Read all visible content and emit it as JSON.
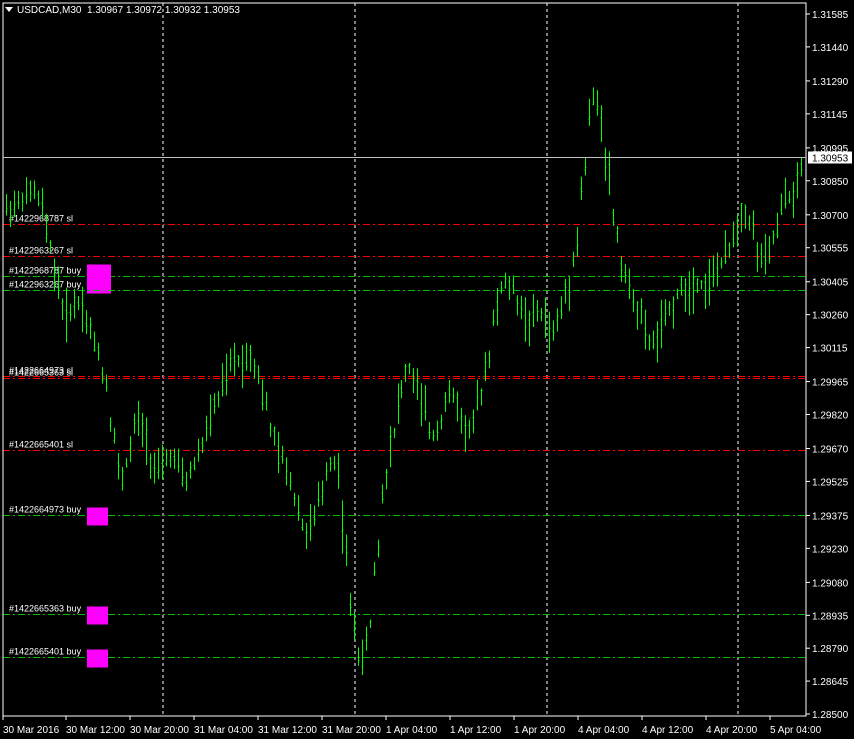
{
  "header": {
    "symbol": "USDCAD,M30",
    "ohlc": "1.30967 1.30972 1.30932 1.30953"
  },
  "colors": {
    "background": "#000000",
    "candle": "#00ff00",
    "grid": "#ffffff",
    "stop_loss": "#ff0000",
    "buy_level": "#00c000",
    "marker": "#ff00ff",
    "bid_line": "#c0c0c0"
  },
  "chart_data": {
    "type": "line",
    "title": "USDCAD,M30",
    "y_ticks": [
      "1.31585",
      "1.31440",
      "1.31290",
      "1.31145",
      "1.30995",
      "1.30850",
      "1.30700",
      "1.30555",
      "1.30405",
      "1.30260",
      "1.30115",
      "1.29965",
      "1.29820",
      "1.29670",
      "1.29525",
      "1.29375",
      "1.29230",
      "1.29080",
      "1.28935",
      "1.28790",
      "1.28645",
      "1.28500"
    ],
    "ylim": [
      1.285,
      1.31585
    ],
    "x_ticks": [
      "30 Mar 2016",
      "30 Mar 12:00",
      "30 Mar 20:00",
      "31 Mar 04:00",
      "31 Mar 12:00",
      "31 Mar 20:00",
      "1 Apr 04:00",
      "1 Apr 12:00",
      "1 Apr 20:00",
      "4 Apr 04:00",
      "4 Apr 12:00",
      "4 Apr 20:00",
      "5 Apr 04:00"
    ],
    "current_price": "1.30953",
    "series": [
      {
        "x_index": [
          0,
          2,
          4,
          6,
          8,
          10,
          12,
          14,
          16,
          18,
          20,
          22,
          24,
          26,
          28,
          30,
          32,
          34,
          36,
          38,
          40,
          42,
          44,
          46,
          48,
          50,
          52,
          54,
          56,
          58,
          60,
          62,
          64,
          66,
          68,
          70,
          72,
          74,
          76,
          78,
          80,
          82,
          84,
          86,
          88,
          90,
          92,
          94,
          96,
          98,
          100,
          102,
          104,
          106,
          108,
          110,
          112,
          114,
          116,
          118,
          120,
          122,
          124,
          126,
          128,
          130,
          132,
          134,
          136,
          138,
          140,
          142,
          144,
          146,
          148,
          150,
          152,
          154,
          156,
          158,
          160,
          162,
          164,
          166,
          168,
          170,
          172,
          174,
          176,
          178,
          180,
          182,
          184,
          186,
          188,
          190,
          192,
          194,
          196,
          198
        ],
        "values": [
          1.3073,
          1.3076,
          1.3079,
          1.3081,
          1.3072,
          1.3052,
          1.3036,
          1.3022,
          1.3034,
          1.3029,
          1.3017,
          1.3008,
          1.2992,
          1.2966,
          1.295,
          1.2972,
          1.2982,
          1.2969,
          1.2955,
          1.296,
          1.2965,
          1.2958,
          1.2951,
          1.2963,
          1.297,
          1.2983,
          1.299,
          1.3001,
          1.3008,
          1.3004,
          1.301,
          1.2997,
          1.2983,
          1.2968,
          1.2961,
          1.2951,
          1.2939,
          1.2927,
          1.2939,
          1.295,
          1.2965,
          1.2956,
          1.291,
          1.2883,
          1.287,
          1.2896,
          1.2932,
          1.2963,
          1.2978,
          1.2997,
          1.3004,
          1.2991,
          1.2981,
          1.297,
          1.2983,
          1.2993,
          1.2986,
          1.2972,
          1.298,
          1.2995,
          1.3012,
          1.3035,
          1.3041,
          1.3036,
          1.3027,
          1.3021,
          1.3029,
          1.3023,
          1.3016,
          1.3032,
          1.3041,
          1.3063,
          1.31,
          1.3128,
          1.3108,
          1.3082,
          1.3055,
          1.3041,
          1.3032,
          1.3024,
          1.3011,
          1.3017,
          1.3026,
          1.3031,
          1.3039,
          1.3036,
          1.3042,
          1.3037,
          1.3045,
          1.3049,
          1.3056,
          1.3068,
          1.3073,
          1.3061,
          1.3047,
          1.3055,
          1.3066,
          1.3081,
          1.3075,
          1.3095
        ]
      }
    ],
    "orders": [
      {
        "label": "#1422968787 sl",
        "price": 1.3066,
        "kind": "sl"
      },
      {
        "label": "#1422963267 sl",
        "price": 1.3052,
        "kind": "sl"
      },
      {
        "label": "#1422968787 buy",
        "price": 1.3043,
        "kind": "buy",
        "marker": "large"
      },
      {
        "label": "#1422963267 buy",
        "price": 1.3037,
        "kind": "buy"
      },
      {
        "label": "#1422664973 sl",
        "price": 1.2999,
        "kind": "sl"
      },
      {
        "label": "#1422665363 sl",
        "price": 1.2998,
        "kind": "sl"
      },
      {
        "label": "#1422665401 sl",
        "price": 1.29665,
        "kind": "sl"
      },
      {
        "label": "#1422664973 buy",
        "price": 1.29375,
        "kind": "buy",
        "marker": "small"
      },
      {
        "label": "#1422665363 buy",
        "price": 1.2894,
        "kind": "buy",
        "marker": "small"
      },
      {
        "label": "#1422665401 buy",
        "price": 1.2875,
        "kind": "buy",
        "marker": "small"
      }
    ]
  }
}
